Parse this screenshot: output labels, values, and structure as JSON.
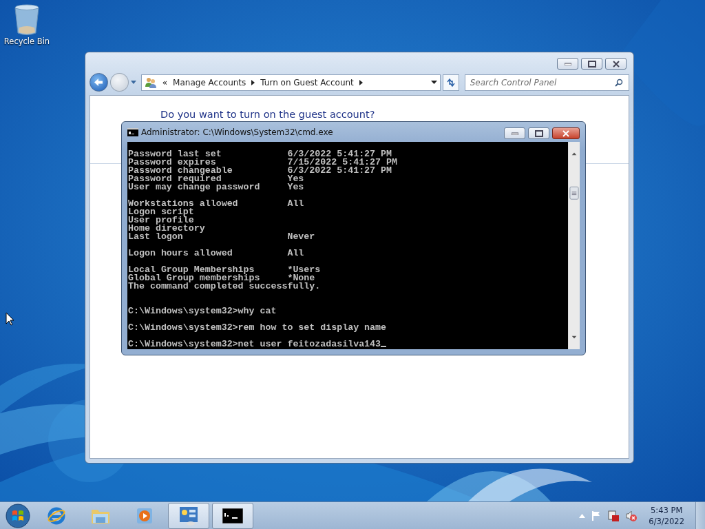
{
  "desktop_icons": [
    {
      "label": "Recycle Bin"
    }
  ],
  "control_panel": {
    "breadcrumb_prefix": "«",
    "breadcrumb": [
      "Manage Accounts",
      "Turn on Guest Account"
    ],
    "search": {
      "placeholder": "Search Control Panel"
    },
    "heading": "Do you want to turn on the guest account?"
  },
  "cmd": {
    "title": "Administrator: C:\\Windows\\System32\\cmd.exe",
    "cursor": true,
    "output_blocks": [
      [
        "Password last set            6/3/2022 5:41:27 PM",
        "Password expires             7/15/2022 5:41:27 PM",
        "Password changeable          6/3/2022 5:41:27 PM",
        "Password required            Yes",
        "User may change password     Yes"
      ],
      [
        "Workstations allowed         All",
        "Logon script",
        "User profile",
        "Home directory",
        "Last logon                   Never"
      ],
      [
        "Logon hours allowed          All"
      ],
      [
        "Local Group Memberships      *Users",
        "Global Group memberships     *None",
        "The command completed successfully."
      ]
    ],
    "commands": [
      "C:\\Windows\\system32>why cat",
      "C:\\Windows\\system32>rem how to set display name",
      "C:\\Windows\\system32>net user feitozadasilva143"
    ]
  },
  "taskbar": {
    "items": [
      {
        "kind": "ie",
        "open": false
      },
      {
        "kind": "explorer",
        "open": false
      },
      {
        "kind": "media",
        "open": false
      },
      {
        "kind": "control",
        "open": true
      },
      {
        "kind": "cmd",
        "open": true
      }
    ]
  },
  "clock": {
    "time": "5:43 PM",
    "date": "6/3/2022"
  }
}
